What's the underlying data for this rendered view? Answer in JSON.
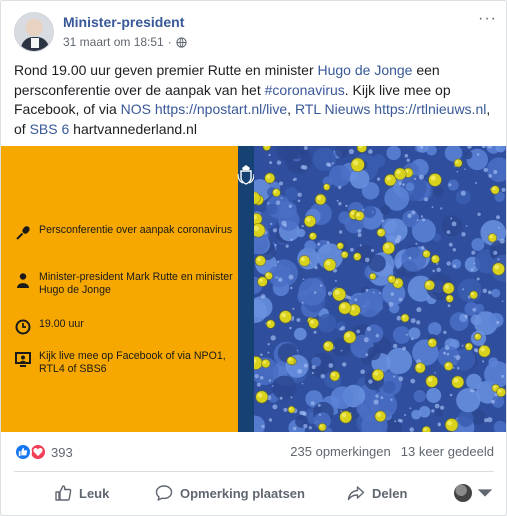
{
  "post": {
    "page_name": "Minister-president",
    "timestamp": "31 maart om 18:51",
    "separator": "·",
    "text": {
      "part1": "Rond 19.00 uur geven premier Rutte en minister ",
      "link1": "Hugo de Jonge",
      "part2": " een persconferentie over de aanpak van het ",
      "link2": "#coronavirus",
      "part3": ". Kijk live mee op Facebook, of via ",
      "link3": "NOS",
      "part4": " ",
      "link4": "https://npostart.nl/live",
      "part5": ", ",
      "link5": "RTL Nieuws",
      "part6": " ",
      "link6": "https://rtlnieuws.nl",
      "part7": ", of ",
      "link7": "SBS 6",
      "part8": " hartvannederland.nl"
    }
  },
  "media": {
    "panel_color": "#f6a800",
    "stripe_color": "#154273",
    "items": [
      {
        "icon": "microphone-icon",
        "text": "Persconferentie over aanpak coronavirus"
      },
      {
        "icon": "person-icon",
        "text": "Minister-president Mark Rutte en minister Hugo de Jonge"
      },
      {
        "icon": "clock-icon",
        "text": "19.00 uur"
      },
      {
        "icon": "tv-icon",
        "text": "Kijk live mee op Facebook of via NPO1, RTL4 of SBS6"
      }
    ]
  },
  "stats": {
    "reactions": [
      "like-reaction-icon",
      "love-reaction-icon"
    ],
    "reaction_count": "393",
    "comments": "235 opmerkingen",
    "shares": "13 keer gedeeld"
  },
  "actions": {
    "like": "Leuk",
    "comment": "Opmerking plaatsen",
    "share": "Delen"
  },
  "colors": {
    "link": "#385898",
    "like": "#1877f2",
    "love": "#f33e58",
    "secondary_text": "#606770"
  }
}
